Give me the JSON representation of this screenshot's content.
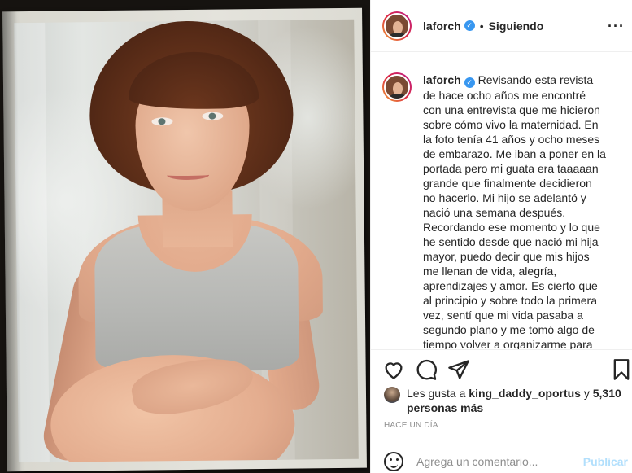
{
  "post": {
    "username": "laforch",
    "verified": true,
    "separator": "•",
    "follow_status": "Siguiendo",
    "caption": "Revisando esta revista de hace ocho años me encontré con una entrevista que me hicieron sobre cómo vivo la maternidad. En la foto tenía 41 años y ocho meses de embarazo. Me iban a poner en la portada pero mi guata era taaaaan grande que finalmente decidieron no hacerlo. Mi hijo se adelantó y nació una semana después. Recordando ese momento y lo que he sentido desde que nació mi hija mayor, puedo decir que mis hijos me llenan de vida, alegría, aprendizajes y amor. Es cierto que al principio y sobre todo la primera vez, sentí que mi vida pasaba a segundo plano y me tomó algo de tiempo volver a organizarme para disfrutar a mi hijos junto a mi libertad",
    "likes_prefix": "Les gusta a",
    "liked_by": "king_daddy_oportus",
    "likes_connector": "y",
    "likes_others": "5,310 personas más",
    "timestamp": "HACE UN DÍA"
  },
  "icons": {
    "like": "heart-icon",
    "comment": "comment-icon",
    "share": "paper-plane-icon",
    "save": "bookmark-icon",
    "more": "more-options-icon",
    "emoji": "emoji-icon",
    "verified": "verified-badge-icon"
  },
  "comment_box": {
    "placeholder": "Agrega un comentario...",
    "submit_label": "Publicar"
  },
  "colors": {
    "verified_blue": "#3897f0",
    "publish_disabled": "#b2dffc",
    "muted_text": "#8e8e8e"
  }
}
